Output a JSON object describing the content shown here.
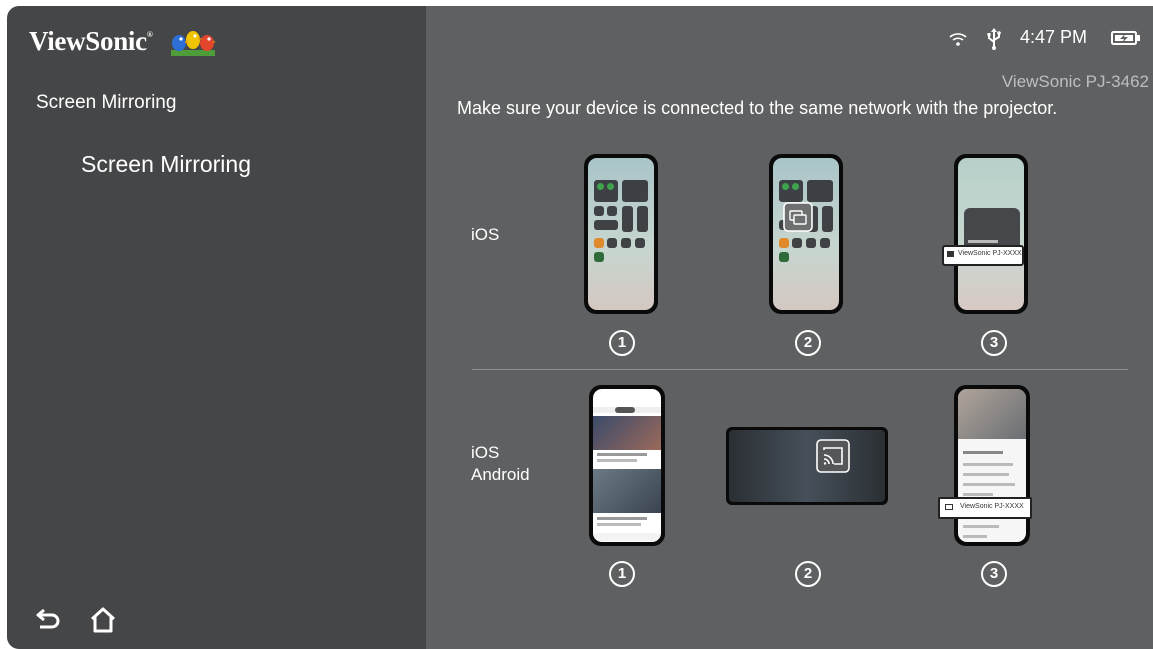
{
  "brand": {
    "name": "ViewSonic",
    "mark": "®"
  },
  "sidebar": {
    "title": "Screen Mirroring",
    "items": [
      {
        "label": "Screen Mirroring"
      }
    ]
  },
  "status_bar": {
    "time": "4:47 PM"
  },
  "device_name": "ViewSonic PJ-3462",
  "instruction": "Make sure your device is connected to the same network with the projector.",
  "rows": [
    {
      "label_lines": [
        "iOS"
      ],
      "steps": [
        "1",
        "2",
        "3"
      ]
    },
    {
      "label_lines": [
        "iOS",
        "Android"
      ],
      "steps": [
        "1",
        "2",
        "3"
      ]
    }
  ],
  "tutorial_text": {
    "ios_popup": "ViewSonic PJ-XXXX",
    "android_popup": "ViewSonic PJ-XXXX"
  },
  "icons": {
    "back": "back-arrow-icon",
    "home": "home-icon",
    "wifi": "wifi-icon",
    "usb": "usb-icon",
    "battery": "battery-charging-icon",
    "cast": "cast-icon",
    "mirror": "screen-mirror-icon"
  },
  "colors": {
    "sidebar": "#454647",
    "main": "#5f6061",
    "accent_green": "#3fa34d"
  }
}
